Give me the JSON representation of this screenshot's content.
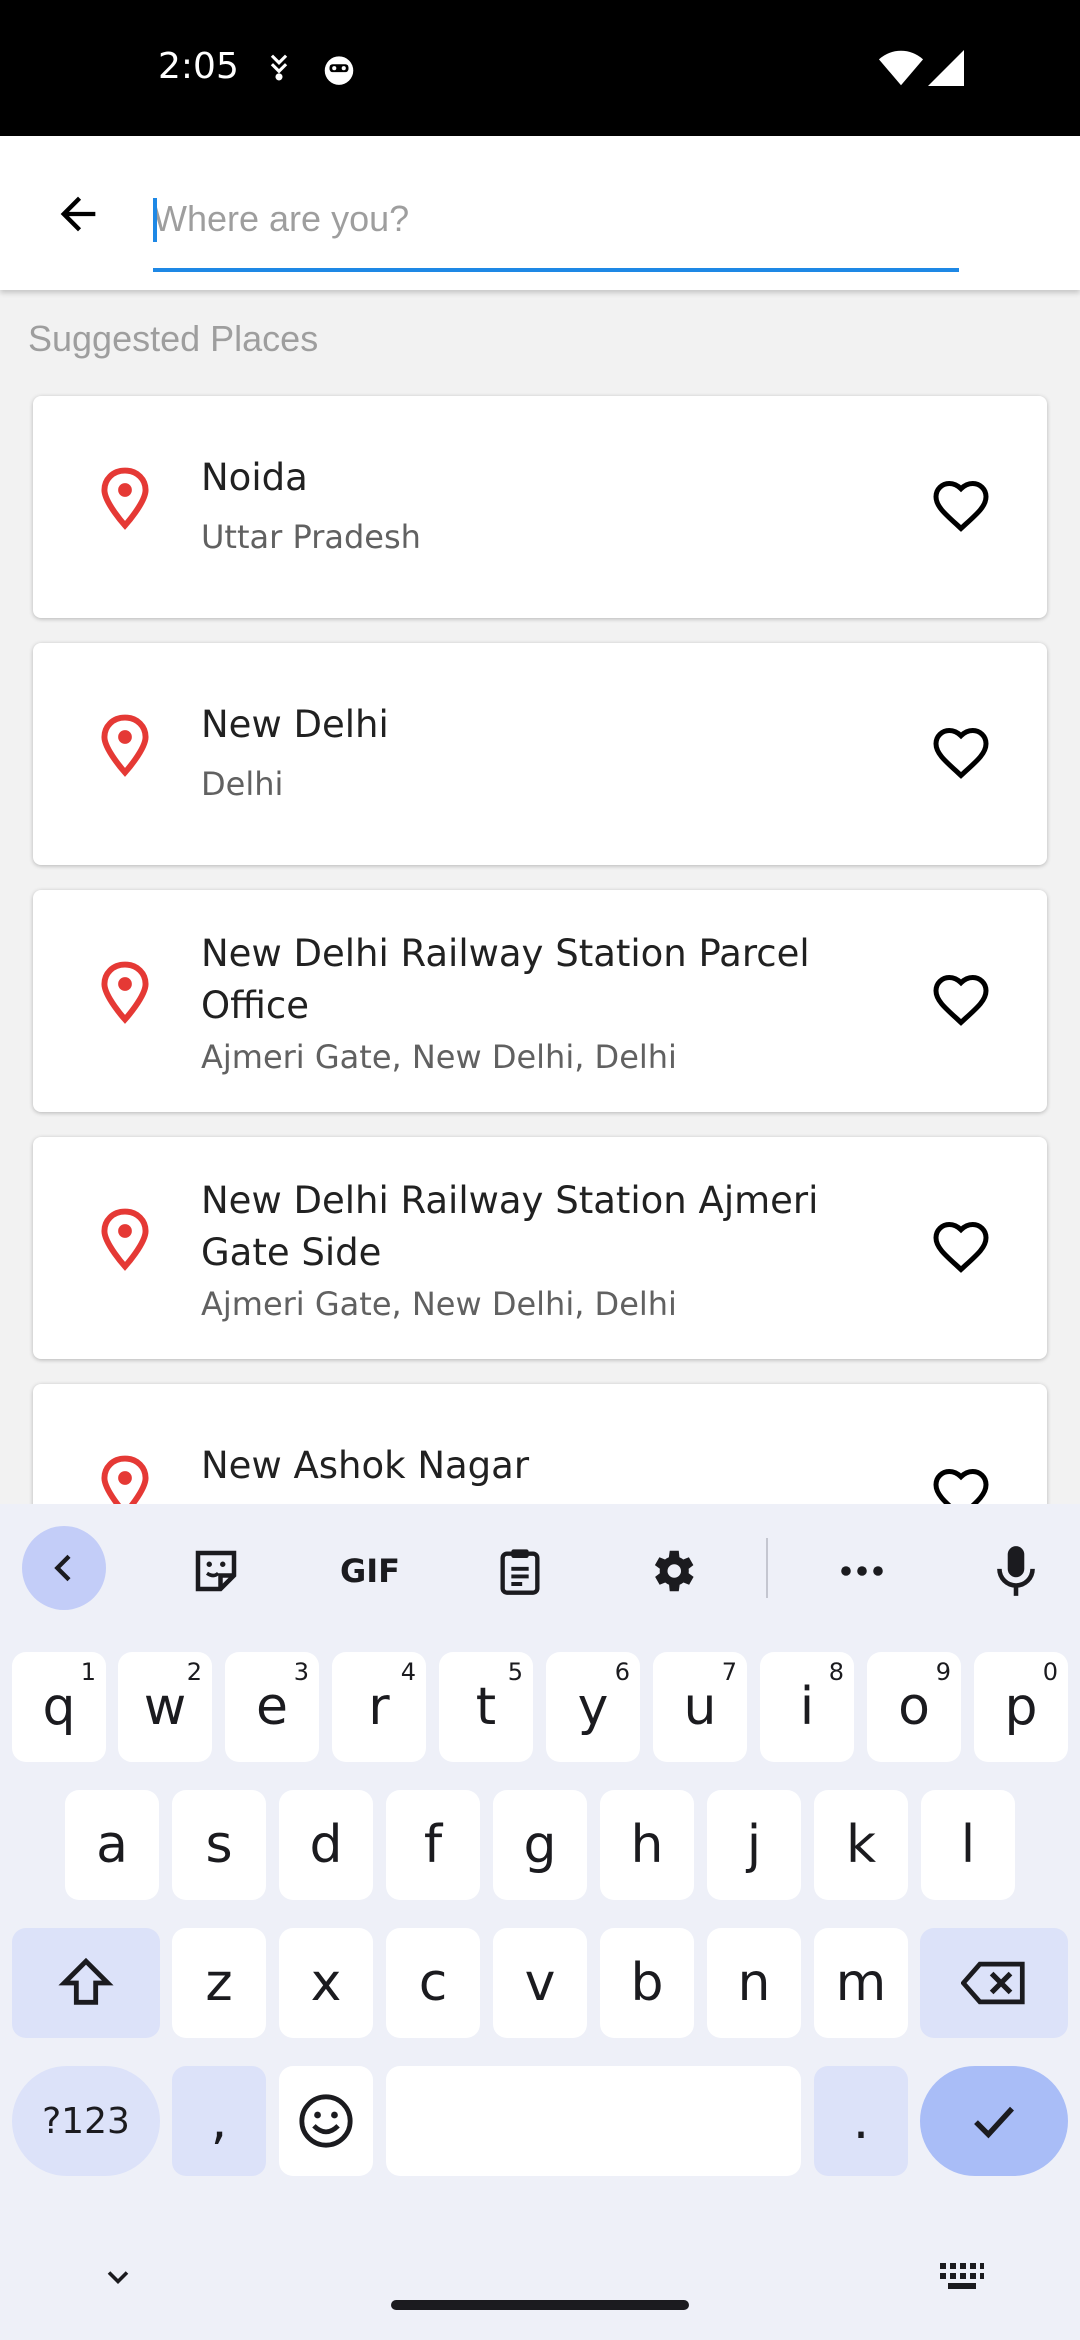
{
  "status_bar": {
    "time": "2:05"
  },
  "search": {
    "placeholder": "Where are you?",
    "value": ""
  },
  "section_title": "Suggested Places",
  "places": [
    {
      "name": "Noida",
      "subtitle": "Uttar Pradesh"
    },
    {
      "name": "New Delhi",
      "subtitle": "Delhi"
    },
    {
      "name": "New Delhi Railway Station Parcel Office",
      "subtitle": "Ajmeri Gate, New Delhi, Delhi"
    },
    {
      "name": "New Delhi Railway Station Ajmeri Gate Side",
      "subtitle": "Ajmeri Gate, New Delhi, Delhi"
    },
    {
      "name": "New Ashok Nagar",
      "subtitle": ""
    }
  ],
  "keyboard": {
    "row1": [
      "q",
      "w",
      "e",
      "r",
      "t",
      "y",
      "u",
      "i",
      "o",
      "p"
    ],
    "row1_hints": [
      "1",
      "2",
      "3",
      "4",
      "5",
      "6",
      "7",
      "8",
      "9",
      "0"
    ],
    "row2": [
      "a",
      "s",
      "d",
      "f",
      "g",
      "h",
      "j",
      "k",
      "l"
    ],
    "row3": [
      "z",
      "x",
      "c",
      "v",
      "b",
      "n",
      "m"
    ],
    "symbols_label": "?123",
    "comma": ",",
    "period": ".",
    "toolbar_gif": "GIF"
  },
  "colors": {
    "accent": "#1e88e5",
    "pin": "#e53935"
  }
}
